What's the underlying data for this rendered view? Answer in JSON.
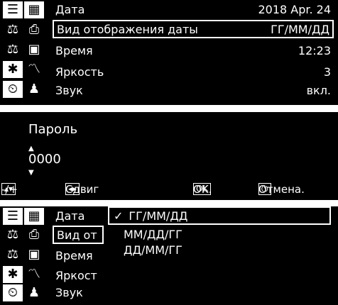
{
  "panel1": {
    "icons": [
      [
        "list-icon",
        "calendar-icon"
      ],
      [
        "scale-icon",
        "printer-icon"
      ],
      [
        "scale-settings-icon",
        "save-icon"
      ],
      [
        "gear-icon",
        "chart-icon"
      ],
      [
        "timer-icon",
        "user-icon"
      ]
    ],
    "rows": [
      {
        "label": "Дата",
        "value": "2018 Apr. 24"
      },
      {
        "label": "Вид отображения даты",
        "value": "ГГ/ММ/ДД"
      },
      {
        "label": "Время",
        "value": "12:23"
      },
      {
        "label": "Яркость",
        "value": "3"
      },
      {
        "label": "Звук",
        "value": "вкл."
      }
    ]
  },
  "panel2": {
    "label": "Пароль",
    "value": "0000",
    "footer": {
      "change": "-/+",
      "shift": "Сдвиг",
      "ok_key": "OK",
      "ok": "OK.",
      "cancel": "Отмена."
    }
  },
  "panel3": {
    "rows": [
      "Дата",
      "Вид от",
      "Время",
      "Яркост",
      "Звук"
    ],
    "options": [
      "ГГ/ММ/ДД",
      "ММ/ДД/ГГ",
      "ДД/ММ/ГГ"
    ]
  }
}
